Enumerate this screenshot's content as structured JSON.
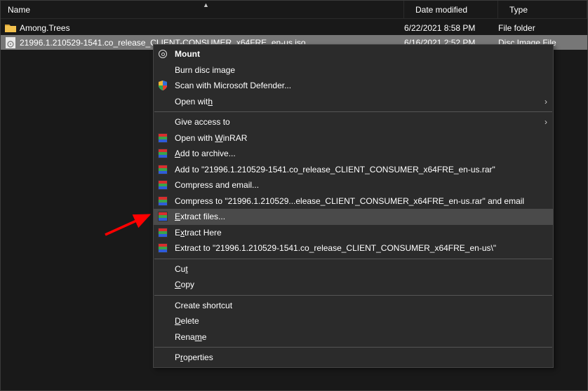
{
  "header": {
    "name": "Name",
    "date": "Date modified",
    "type": "Type"
  },
  "files": [
    {
      "name": "Among.Trees",
      "date": "6/22/2021 8:58 PM",
      "type": "File folder"
    },
    {
      "name": "21996.1.210529-1541.co_release_CLIENT-CONSUMER_x64FRE_en-us.iso",
      "date": "6/16/2021 2:52 PM",
      "type": "Disc Image File"
    }
  ],
  "menu": {
    "mount": "Mount",
    "burn": "Burn disc image",
    "defender": "Scan with Microsoft Defender...",
    "openwith": "Open with",
    "giveaccess": "Give access to",
    "openrar": "Open with WinRAR",
    "addarchive": "Add to archive...",
    "addto": "Add to \"21996.1.210529-1541.co_release_CLIENT_CONSUMER_x64FRE_en-us.rar\"",
    "compressemail": "Compress and email...",
    "compressto": "Compress to \"21996.1.210529...elease_CLIENT_CONSUMER_x64FRE_en-us.rar\" and email",
    "extractfiles": "Extract files...",
    "extracthere": "Extract Here",
    "extractto": "Extract to \"21996.1.210529-1541.co_release_CLIENT_CONSUMER_x64FRE_en-us\\\"",
    "cut": "Cut",
    "copy": "Copy",
    "shortcut": "Create shortcut",
    "delete": "Delete",
    "rename": "Rename",
    "properties": "Properties"
  }
}
